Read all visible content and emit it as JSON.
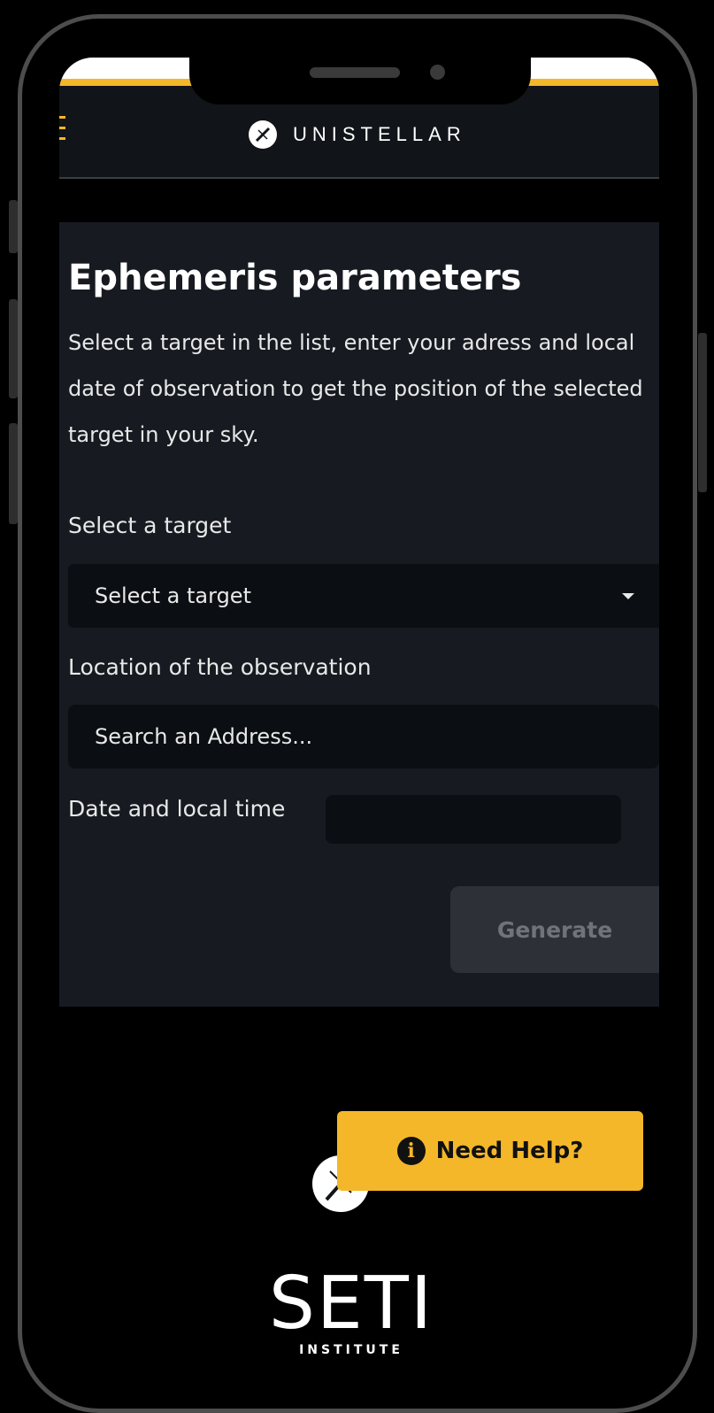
{
  "header": {
    "brand_name": "UNISTELLAR"
  },
  "form": {
    "title": "Ephemeris parameters",
    "description": "Select a target in the list, enter your adress and local date of observation to get the position of the selected target in your sky.",
    "target_label": "Select a target",
    "target_selected": "Select a target",
    "location_label": "Location of the observation",
    "address_placeholder": "Search an Address...",
    "date_label": "Date and local time",
    "generate_label": "Generate"
  },
  "help": {
    "label": "Need Help?",
    "icon_glyph": "i"
  },
  "footer": {
    "seti_wordmark": "SETI",
    "seti_sub": "INSTITUTE"
  },
  "colors": {
    "accent": "#f4b729",
    "panel": "#171b21",
    "header": "#111418",
    "field": "#0b0e12",
    "button_disabled": "#2d3137"
  },
  "icons": {
    "menu": "hamburger-menu-icon",
    "brand": "unistellar-logo-icon",
    "caret": "caret-down-icon",
    "info": "info-icon"
  }
}
